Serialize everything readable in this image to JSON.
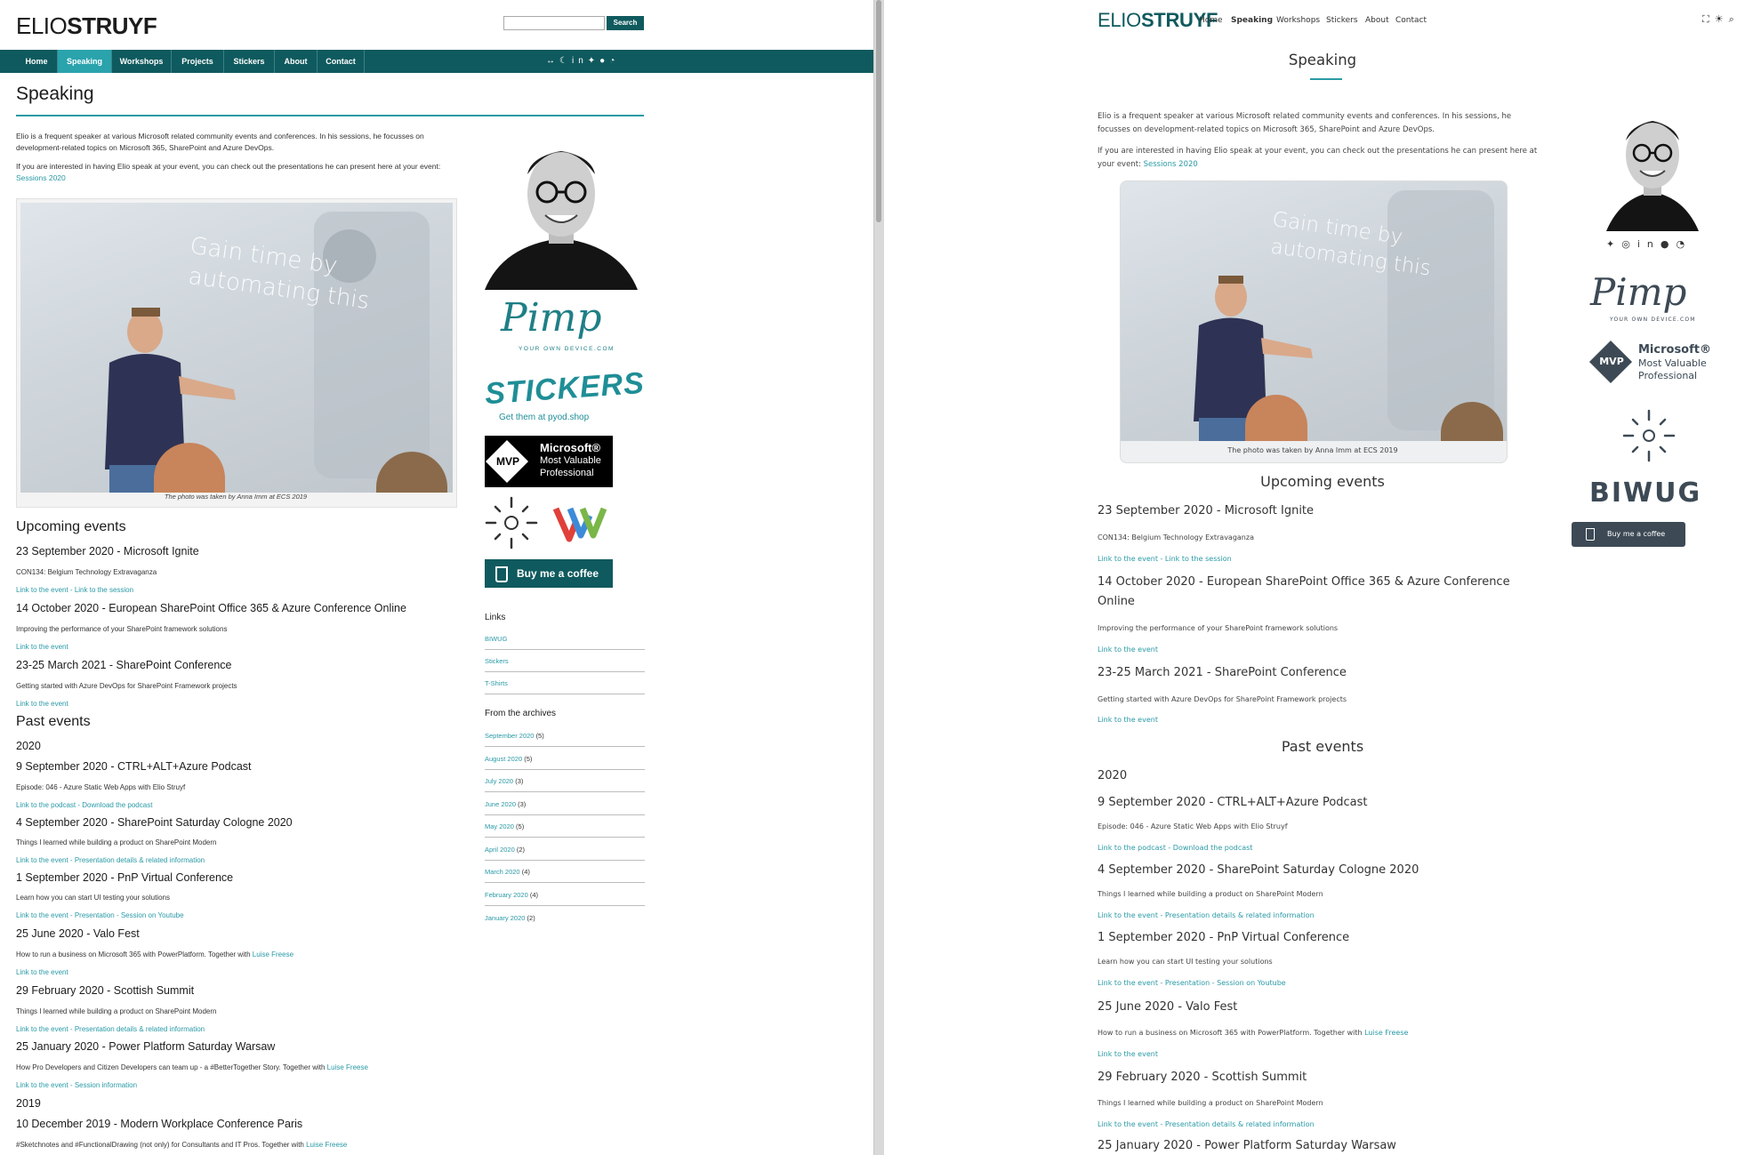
{
  "site": {
    "logo_prefix": "ELIO",
    "logo_suffix": "STRUYF"
  },
  "left": {
    "search_button": "Search",
    "nav": [
      {
        "label": "Home",
        "active": false
      },
      {
        "label": "Speaking",
        "active": true
      },
      {
        "label": "Workshops",
        "active": false
      },
      {
        "label": "Projects",
        "active": false
      },
      {
        "label": "Stickers",
        "active": false
      },
      {
        "label": "About",
        "active": false
      },
      {
        "label": "Contact",
        "active": false
      }
    ],
    "nav_icons": [
      "swap-icon",
      "moon-icon",
      "linkedin-icon",
      "twitter-icon",
      "github-icon",
      "rss-icon"
    ],
    "page_title": "Speaking",
    "intro_1": "Elio is a frequent speaker at various Microsoft related community events and conferences. In his sessions, he focusses on development-related topics on Microsoft 365, SharePoint and Azure DevOps.",
    "intro_2_prefix": "If you are interested in having Elio speak at your event, you can check out the presentations he can present here at your event: ",
    "intro_2_link": "Sessions 2020",
    "photo_slide_line1": "Gain time by",
    "photo_slide_line2": "automating this",
    "photo_caption": "The photo was taken by Anna Imm at ECS 2019",
    "upcoming_heading": "Upcoming events",
    "upcoming": [
      {
        "title": "23 September 2020 - Microsoft Ignite",
        "desc": "CON134: Belgium Technology Extravaganza",
        "links": "Link to the event - Link to the session"
      },
      {
        "title": "14 October 2020 - European SharePoint Office 365 & Azure Conference Online",
        "desc": "Improving the performance of your SharePoint framework solutions",
        "links": "Link to the event"
      },
      {
        "title": "23-25 March 2021 - SharePoint Conference",
        "desc": "Getting started with Azure DevOps for SharePoint Framework projects",
        "links": "Link to the event"
      }
    ],
    "past_heading": "Past events",
    "year_2020": "2020",
    "past": [
      {
        "title": "9 September 2020 - CTRL+ALT+Azure Podcast",
        "desc": "Episode: 046 - Azure Static Web Apps with Elio Struyf",
        "links": "Link to the podcast - Download the podcast"
      },
      {
        "title": "4 September 2020 - SharePoint Saturday Cologne 2020",
        "desc": "Things I learned while building a product on SharePoint Modern",
        "links": "Link to the event - Presentation details & related information"
      },
      {
        "title": "1 September 2020 - PnP Virtual Conference",
        "desc": "Learn how you can start UI testing your solutions",
        "links": "Link to the event - Presentation - Session on Youtube"
      },
      {
        "title": "25 June 2020 - Valo Fest",
        "desc": "How to run a business on Microsoft 365 with PowerPlatform. Together with ",
        "desc_link": "Luise Freese",
        "links": "Link to the event"
      },
      {
        "title": "29 February 2020 - Scottish Summit",
        "desc": "Things I learned while building a product on SharePoint Modern",
        "links": "Link to the event - Presentation details & related information"
      },
      {
        "title": "25 January 2020 - Power Platform Saturday Warsaw",
        "desc": "How Pro Developers and Citizen Developers can team up - a #BetterTogether Story. Together with ",
        "desc_link": "Luise Freese",
        "links": "Link to the event - Session information"
      }
    ],
    "year_2019": "2019",
    "past_2019": [
      {
        "title": "10 December 2019 - Modern Workplace Conference Paris",
        "desc": "#Sketchnotes and #FunctionalDrawing (not only) for Consultants and IT Pros. Together with ",
        "desc_link": "Luise Freese"
      }
    ],
    "sidebar": {
      "pimp_title": "Pimp",
      "pimp_sub": "YOUR OWN DEVICE.COM",
      "stickers_title": "STICKERS",
      "stickers_sub": "Get them at pyod.shop",
      "mvp_badge": "MVP",
      "mvp_line1": "Microsoft®",
      "mvp_line2": "Most Valuable",
      "mvp_line3": "Professional",
      "coffee": "Buy me a coffee",
      "links_heading": "Links",
      "links": [
        "BIWUG",
        "Stickers",
        "T-Shirts"
      ],
      "archives_heading": "From the archives",
      "archives": [
        {
          "label": "September 2020",
          "count": "(5)"
        },
        {
          "label": "August 2020",
          "count": "(5)"
        },
        {
          "label": "July 2020",
          "count": "(3)"
        },
        {
          "label": "June 2020",
          "count": "(3)"
        },
        {
          "label": "May 2020",
          "count": "(5)"
        },
        {
          "label": "April 2020",
          "count": "(2)"
        },
        {
          "label": "March 2020",
          "count": "(4)"
        },
        {
          "label": "February 2020",
          "count": "(4)"
        },
        {
          "label": "January 2020",
          "count": "(2)"
        }
      ]
    }
  },
  "right": {
    "nav": [
      {
        "label": "Home",
        "active": false
      },
      {
        "label": "Speaking",
        "active": true
      },
      {
        "label": "Workshops",
        "active": false
      },
      {
        "label": "Stickers",
        "active": false
      },
      {
        "label": "About",
        "active": false
      },
      {
        "label": "Contact",
        "active": false
      }
    ],
    "page_title": "Speaking",
    "intro_1": "Elio is a frequent speaker at various Microsoft related community events and conferences. In his sessions, he focusses on development-related topics on Microsoft 365, SharePoint and Azure DevOps.",
    "intro_2_prefix": "If you are interested in having Elio speak at your event, you can check out the presentations he can present here at your event: ",
    "intro_2_link": "Sessions 2020",
    "photo_caption": "The photo was taken by Anna Imm at ECS 2019",
    "upcoming_heading": "Upcoming events",
    "past_heading": "Past events",
    "year_2020": "2020",
    "last_visible_title": "25 January 2020 - Power Platform Saturday Warsaw",
    "sidebar": {
      "biwug": "BIWUG",
      "coffee": "Buy me a coffee"
    }
  },
  "colors": {
    "teal_dark": "#0f5a5e",
    "teal_accent": "#2aa3ad",
    "link": "#2a9aa6"
  }
}
